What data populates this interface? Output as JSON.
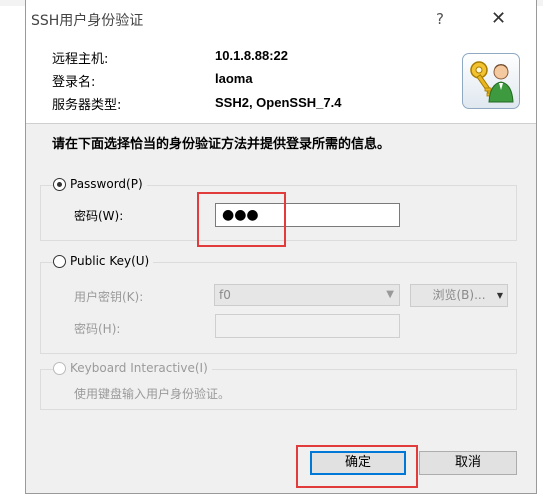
{
  "window": {
    "title": "SSH用户身份验证",
    "help": "?",
    "close": "✕"
  },
  "info": {
    "host_label": "远程主机:",
    "host_value": "10.1.8.88:22",
    "user_label": "登录名:",
    "user_value": "laoma",
    "server_label": "服务器类型:",
    "server_value": "SSH2, OpenSSH_7.4",
    "icon": "key-user-icon"
  },
  "instruction": "请在下面选择恰当的身份验证方法并提供登录所需的信息。",
  "password_group": {
    "radio_label": "Password(P)",
    "selected": true,
    "field_label": "密码(W):",
    "field_value": "●●●"
  },
  "publickey_group": {
    "radio_label": "Public Key(U)",
    "selected": false,
    "key_label": "用户密钥(K):",
    "key_value": "f0",
    "browse_label": "浏览(B)...",
    "passphrase_label": "密码(H):",
    "passphrase_value": ""
  },
  "keyboard_group": {
    "radio_label": "Keyboard Interactive(I)",
    "selected": false,
    "description": "使用键盘输入用户身份验证。"
  },
  "buttons": {
    "ok": "确定",
    "cancel": "取消"
  },
  "colors": {
    "highlight": "#e23b3b",
    "dialog_bg": "#f0f0f0",
    "default_border": "#0078d7"
  }
}
